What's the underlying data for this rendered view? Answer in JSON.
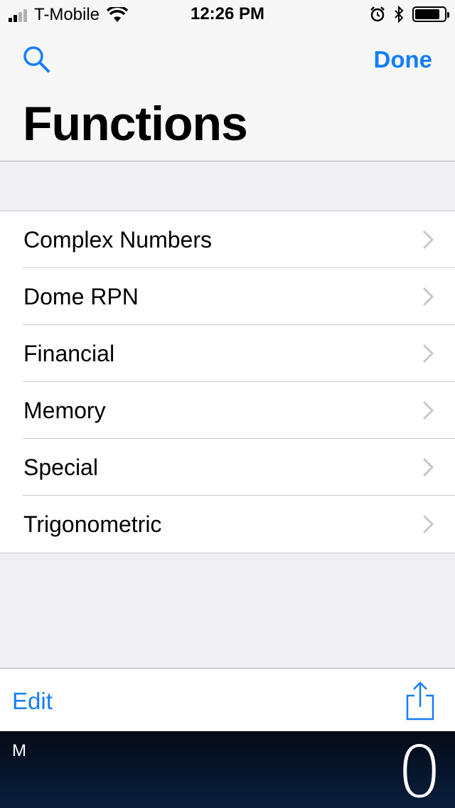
{
  "status_bar": {
    "carrier": "T-Mobile",
    "time": "12:26 PM",
    "battery_level": 0.85
  },
  "navbar": {
    "done_label": "Done",
    "title": "Functions"
  },
  "functions": [
    {
      "label": "Complex Numbers"
    },
    {
      "label": "Dome RPN"
    },
    {
      "label": "Financial"
    },
    {
      "label": "Memory"
    },
    {
      "label": "Special"
    },
    {
      "label": "Trigonometric"
    }
  ],
  "toolbar": {
    "edit_label": "Edit"
  },
  "display": {
    "memory_indicator": "M",
    "value": "0"
  },
  "colors": {
    "accent": "#147efb",
    "display_bg": "#0a1f3d"
  },
  "icons": {
    "search": "search-icon",
    "share": "share-icon",
    "chevron": "chevron-right-icon",
    "wifi": "wifi-icon",
    "alarm": "alarm-icon",
    "bluetooth": "bluetooth-icon",
    "battery": "battery-icon"
  }
}
